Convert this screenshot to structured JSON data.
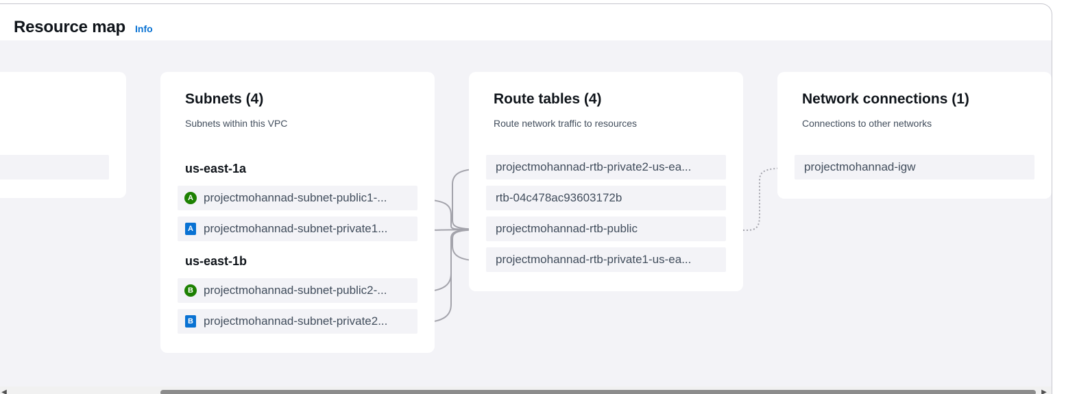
{
  "header": {
    "title": "Resource map",
    "info_label": "Info"
  },
  "subnets": {
    "title": "Subnets (4)",
    "description": "Subnets within this VPC",
    "zones": [
      {
        "name": "us-east-1a",
        "items": [
          {
            "label": "projectmohannad-subnet-public1-...",
            "badge": "A",
            "badge_shape": "circle",
            "badge_color": "#1d8102"
          },
          {
            "label": "projectmohannad-subnet-private1...",
            "badge": "A",
            "badge_shape": "square",
            "badge_color": "#0972d3"
          }
        ]
      },
      {
        "name": "us-east-1b",
        "items": [
          {
            "label": "projectmohannad-subnet-public2-...",
            "badge": "B",
            "badge_shape": "circle",
            "badge_color": "#1d8102"
          },
          {
            "label": "projectmohannad-subnet-private2...",
            "badge": "B",
            "badge_shape": "square",
            "badge_color": "#0972d3"
          }
        ]
      }
    ]
  },
  "route_tables": {
    "title": "Route tables (4)",
    "description": "Route network traffic to resources",
    "items": [
      {
        "label": "projectmohannad-rtb-private2-us-ea..."
      },
      {
        "label": "rtb-04c478ac93603172b"
      },
      {
        "label": "projectmohannad-rtb-public"
      },
      {
        "label": "projectmohannad-rtb-private1-us-ea..."
      }
    ]
  },
  "network_connections": {
    "title": "Network connections (1)",
    "description": "Connections to other networks",
    "items": [
      {
        "label": "projectmohannad-igw"
      }
    ]
  },
  "scrollbar": {
    "left_arrow": "◀",
    "right_arrow": "▶"
  }
}
